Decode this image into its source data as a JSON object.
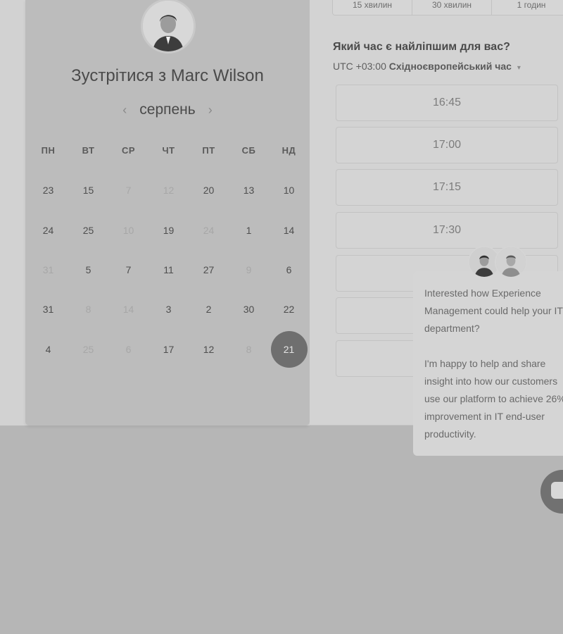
{
  "duration_tabs": [
    "15 хвилин",
    "30 хвилин",
    "1 годин"
  ],
  "header": {
    "title": "Зустрітися з Marc Wilson"
  },
  "calendar": {
    "month": "серпень",
    "prev_icon": "chevron-left-icon",
    "next_icon": "chevron-right-icon",
    "weekdays": [
      "ПН",
      "ВТ",
      "СР",
      "ЧТ",
      "ПТ",
      "СБ",
      "НД"
    ],
    "rows": [
      [
        {
          "d": "23",
          "m": false
        },
        {
          "d": "15",
          "m": false
        },
        {
          "d": "7",
          "m": true
        },
        {
          "d": "12",
          "m": true
        },
        {
          "d": "20",
          "m": false
        },
        {
          "d": "13",
          "m": false
        },
        {
          "d": "10",
          "m": false
        }
      ],
      [
        {
          "d": "24",
          "m": false
        },
        {
          "d": "25",
          "m": false
        },
        {
          "d": "10",
          "m": true
        },
        {
          "d": "19",
          "m": false
        },
        {
          "d": "24",
          "m": true
        },
        {
          "d": "1",
          "m": false
        },
        {
          "d": "14",
          "m": false
        }
      ],
      [
        {
          "d": "31",
          "m": true
        },
        {
          "d": "5",
          "m": false
        },
        {
          "d": "7",
          "m": false
        },
        {
          "d": "11",
          "m": false
        },
        {
          "d": "27",
          "m": false
        },
        {
          "d": "9",
          "m": true
        },
        {
          "d": "6",
          "m": false
        }
      ],
      [
        {
          "d": "31",
          "m": false
        },
        {
          "d": "8",
          "m": true
        },
        {
          "d": "14",
          "m": true
        },
        {
          "d": "3",
          "m": false
        },
        {
          "d": "2",
          "m": false
        },
        {
          "d": "30",
          "m": false
        },
        {
          "d": "22",
          "m": false
        }
      ],
      [
        {
          "d": "4",
          "m": false
        },
        {
          "d": "25",
          "m": true
        },
        {
          "d": "6",
          "m": true
        },
        {
          "d": "17",
          "m": false
        },
        {
          "d": "12",
          "m": false
        },
        {
          "d": "8",
          "m": true
        },
        {
          "d": "21",
          "m": false,
          "selected": true
        }
      ]
    ]
  },
  "time_section": {
    "title": "Який час є найліпшим для вас?",
    "tz_offset": "UTC +03:00",
    "tz_name": "Східноєвропейський час",
    "tz_caret": "▾",
    "slots": [
      "16:45",
      "17:00",
      "17:15",
      "17:30",
      "",
      "",
      ""
    ]
  },
  "chat": {
    "message": "Interested how Experience Management could help your IT department?\n\nI'm happy to help and share insight into how our customers use our platform to achieve 26% improvement in IT end-user productivity."
  },
  "colors": {
    "selected_day": "#6f6f6f",
    "overlay": "#b6b6b6"
  }
}
